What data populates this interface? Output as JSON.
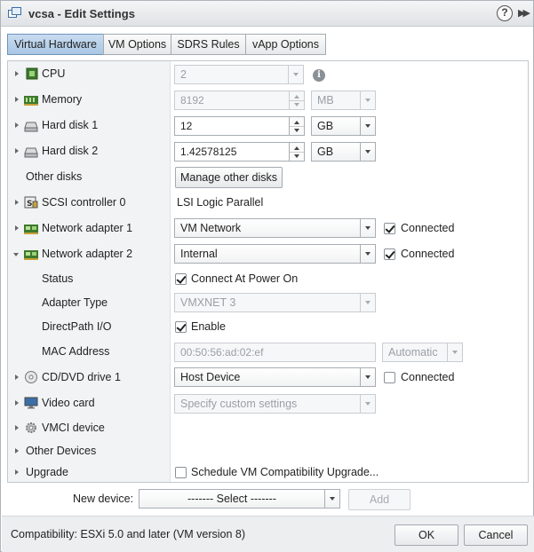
{
  "window": {
    "title": "vcsa - Edit Settings",
    "help_label": "?",
    "more_label": "▶▶"
  },
  "tabs": [
    {
      "label": "Virtual Hardware",
      "active": true
    },
    {
      "label": "VM Options"
    },
    {
      "label": "SDRS Rules"
    },
    {
      "label": "vApp Options"
    }
  ],
  "hardware": {
    "cpu": {
      "label": "CPU",
      "value": "2"
    },
    "memory": {
      "label": "Memory",
      "value": "8192",
      "unit": "MB"
    },
    "disk1": {
      "label": "Hard disk 1",
      "value": "12",
      "unit": "GB"
    },
    "disk2": {
      "label": "Hard disk 2",
      "value": "1.42578125",
      "unit": "GB"
    },
    "other_disks": {
      "label": "Other disks",
      "button": "Manage other disks"
    },
    "scsi": {
      "label": "SCSI controller 0",
      "value": "LSI Logic Parallel"
    },
    "net1": {
      "label": "Network adapter 1",
      "value": "VM Network",
      "connected_label": "Connected",
      "connected": true
    },
    "net2": {
      "label": "Network adapter 2",
      "value": "Internal",
      "connected_label": "Connected",
      "connected": true,
      "status": {
        "label": "Status",
        "value": "Connect At Power On",
        "checked": true
      },
      "adapter_type": {
        "label": "Adapter Type",
        "value": "VMXNET 3"
      },
      "directpath": {
        "label": "DirectPath I/O",
        "value": "Enable",
        "checked": true
      },
      "mac": {
        "label": "MAC Address",
        "value": "00:50:56:ad:02:ef",
        "mode": "Automatic"
      }
    },
    "cdrom": {
      "label": "CD/DVD drive 1",
      "value": "Host Device",
      "connected_label": "Connected",
      "connected": false
    },
    "video": {
      "label": "Video card",
      "value": "Specify custom settings"
    },
    "vmci": {
      "label": "VMCI device"
    },
    "other_devices": {
      "label": "Other Devices"
    },
    "upgrade": {
      "label": "Upgrade",
      "value": "Schedule VM Compatibility Upgrade...",
      "checked": false
    }
  },
  "new_device": {
    "label": "New device:",
    "value": "------- Select -------",
    "add_label": "Add"
  },
  "footer": {
    "compatibility": "Compatibility: ESXi 5.0 and later (VM version 8)",
    "ok_label": "OK",
    "cancel_label": "Cancel"
  }
}
